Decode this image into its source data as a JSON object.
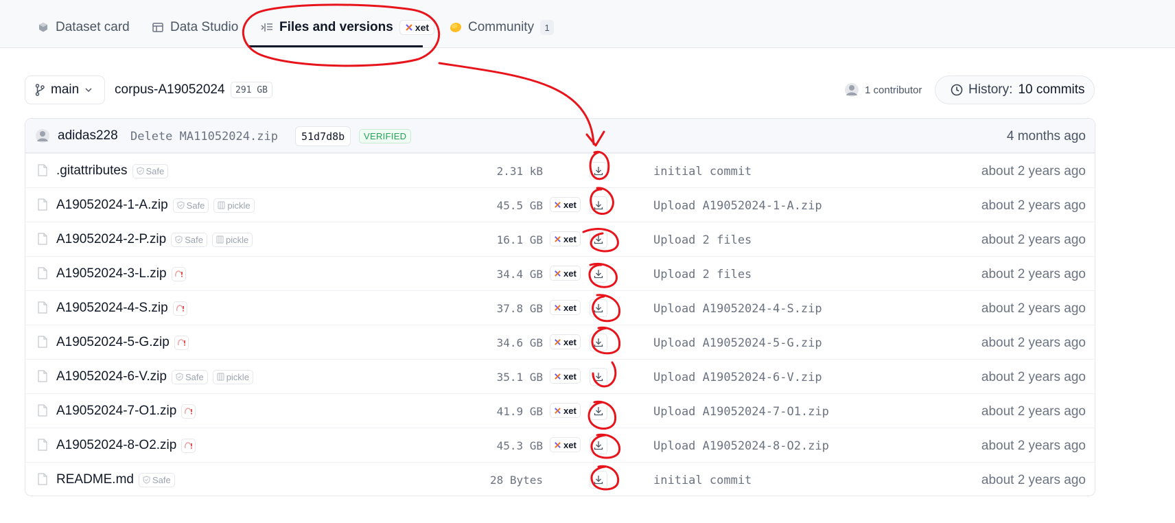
{
  "tabs": [
    {
      "label": "Dataset card",
      "icon": "cube-icon"
    },
    {
      "label": "Data Studio",
      "icon": "table-icon"
    },
    {
      "label": "Files and versions",
      "icon": "files-icon",
      "badge": "xet",
      "active": true
    },
    {
      "label": "Community",
      "icon": "community-icon",
      "count": "1"
    }
  ],
  "repo": {
    "branch": "main",
    "path": "corpus-A19052024",
    "size": "291 GB",
    "contributors": "1 contributor",
    "history_label": "History:",
    "history_value": "10 commits"
  },
  "last_commit": {
    "author": "adidas228",
    "message": "Delete MA11052024.zip",
    "hash": "51d7d8b",
    "verified": "VERIFIED",
    "time": "4 months ago"
  },
  "files": [
    {
      "name": ".gitattributes",
      "safe": "Safe",
      "pickle": null,
      "warn": false,
      "size": "2.31 kB",
      "xet": false,
      "commit": "initial commit",
      "time": "about 2 years ago"
    },
    {
      "name": "A19052024-1-A.zip",
      "safe": "Safe",
      "pickle": "pickle",
      "warn": false,
      "size": "45.5 GB",
      "xet": true,
      "commit": "Upload A19052024-1-A.zip",
      "time": "about 2 years ago"
    },
    {
      "name": "A19052024-2-P.zip",
      "safe": "Safe",
      "pickle": "pickle",
      "warn": false,
      "size": "16.1 GB",
      "xet": true,
      "commit": "Upload 2 files",
      "time": "about 2 years ago"
    },
    {
      "name": "A19052024-3-L.zip",
      "safe": null,
      "pickle": null,
      "warn": true,
      "size": "34.4 GB",
      "xet": true,
      "commit": "Upload 2 files",
      "time": "about 2 years ago"
    },
    {
      "name": "A19052024-4-S.zip",
      "safe": null,
      "pickle": null,
      "warn": true,
      "size": "37.8 GB",
      "xet": true,
      "commit": "Upload A19052024-4-S.zip",
      "time": "about 2 years ago"
    },
    {
      "name": "A19052024-5-G.zip",
      "safe": null,
      "pickle": null,
      "warn": true,
      "size": "34.6 GB",
      "xet": true,
      "commit": "Upload A19052024-5-G.zip",
      "time": "about 2 years ago"
    },
    {
      "name": "A19052024-6-V.zip",
      "safe": "Safe",
      "pickle": "pickle",
      "warn": false,
      "size": "35.1 GB",
      "xet": true,
      "commit": "Upload A19052024-6-V.zip",
      "time": "about 2 years ago"
    },
    {
      "name": "A19052024-7-O1.zip",
      "safe": null,
      "pickle": null,
      "warn": true,
      "size": "41.9 GB",
      "xet": true,
      "commit": "Upload A19052024-7-O1.zip",
      "time": "about 2 years ago"
    },
    {
      "name": "A19052024-8-O2.zip",
      "safe": null,
      "pickle": null,
      "warn": true,
      "size": "45.3 GB",
      "xet": true,
      "commit": "Upload A19052024-8-O2.zip",
      "time": "about 2 years ago"
    },
    {
      "name": "README.md",
      "safe": "Safe",
      "pickle": null,
      "warn": false,
      "size": "28 Bytes",
      "xet": false,
      "commit": "initial commit",
      "time": "about 2 years ago"
    }
  ],
  "colors": {
    "annotation": "#e8141b",
    "verified": "#22a559",
    "xet_mark": "#6d5cf6"
  }
}
